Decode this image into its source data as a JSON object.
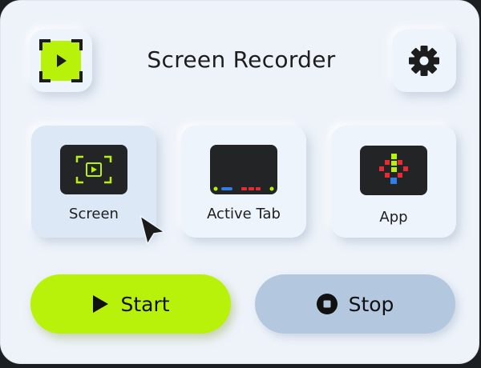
{
  "app": {
    "title": "Screen Recorder"
  },
  "modes": [
    {
      "id": "screen",
      "label": "Screen",
      "selected": true,
      "icon": "screen-capture-icon"
    },
    {
      "id": "active-tab",
      "label": "Active Tab",
      "selected": false,
      "icon": "browser-tab-icon"
    },
    {
      "id": "app",
      "label": "App",
      "selected": false,
      "icon": "app-grid-icon"
    }
  ],
  "actions": {
    "start_label": "Start",
    "stop_label": "Stop"
  },
  "colors": {
    "accent": "#b8f20a",
    "stop": "#b3c8df",
    "panel": "#eef3fa"
  },
  "icons": {
    "logo": "record-screen-icon",
    "settings": "gear-icon",
    "start": "play-icon",
    "stop": "stop-icon",
    "pointer": "mouse-cursor-icon"
  }
}
